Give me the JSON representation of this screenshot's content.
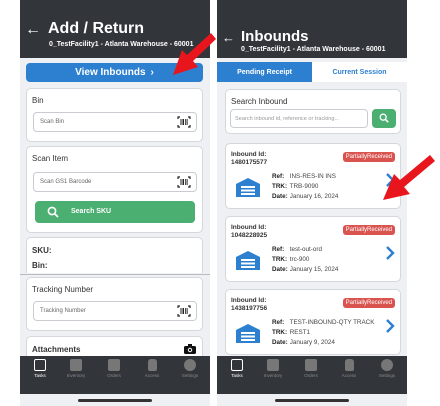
{
  "left": {
    "title": "Add / Return",
    "subtitle": "0_TestFacility1 - Atlanta Warehouse - 60001",
    "view_inbounds": "View Inbounds",
    "bin": {
      "label": "Bin",
      "placeholder": "Scan Bin"
    },
    "scan_item": {
      "label": "Scan Item",
      "placeholder": "Scan GS1 Barcode",
      "search_sku": "Search SKU"
    },
    "sku_label": "SKU:",
    "bin_label": "Bin:",
    "tracking": {
      "label": "Tracking Number",
      "placeholder": "Tracking Number"
    },
    "attachments": "Attachments"
  },
  "right": {
    "title": "Inbounds",
    "subtitle": "0_TestFacility1 - Atlanta Warehouse - 60001",
    "tabs": [
      "Pending Receipt",
      "Current Session"
    ],
    "search": {
      "label": "Search Inbound",
      "placeholder": "Search inbound id, reference or tracking..."
    },
    "inbounds": [
      {
        "id_label": "Inbound Id:",
        "id": "1480175577",
        "status": "PartiallyReceived",
        "ref": "INS-RES-IN INS",
        "trk": "TRB-9090",
        "date": "January 16, 2024"
      },
      {
        "id_label": "Inbound Id:",
        "id": "1048228925",
        "status": "PartiallyReceived",
        "ref": "test-out-ord",
        "trk": "trc-900",
        "date": "January 15, 2024"
      },
      {
        "id_label": "Inbound Id:",
        "id": "1438197756",
        "status": "PartiallyReceived",
        "ref": "TEST-INBOUND-QTY TRACK",
        "trk": "REST1",
        "date": "January 9, 2024"
      }
    ],
    "row_labels": {
      "ref": "Ref:",
      "trk": "TRK:",
      "date": "Date:"
    }
  },
  "tabbar": [
    "Tasks",
    "Inventory",
    "Orders",
    "Access",
    "Settings"
  ],
  "colors": {
    "header": "#32363b",
    "primary_blue": "#2d7fd0",
    "green": "#4caf72",
    "badge_red": "#d9534f",
    "annotation_red": "#e8161c"
  }
}
